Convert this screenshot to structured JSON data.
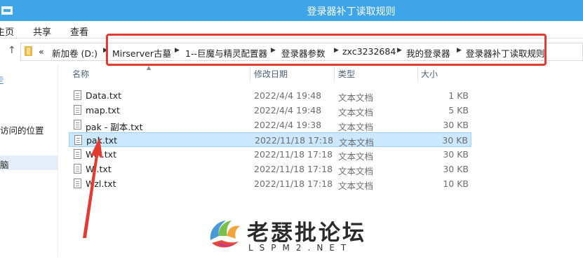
{
  "window": {
    "title": "登录器补丁读取规则"
  },
  "ribbon": {
    "tabs": [
      "主页",
      "共享",
      "查看"
    ]
  },
  "address": {
    "prefix": "«",
    "segments": [
      "新加卷 (D:)",
      "Mirserver古墓",
      "1--巨魔与精灵配置器",
      "登录器参数",
      "zxc3232684",
      "我的登录器",
      "登录器补丁读取规则"
    ]
  },
  "nav": {
    "items": [
      "走",
      "访问的位置",
      "脑"
    ]
  },
  "columns": {
    "name": "名称",
    "date": "修改日期",
    "type": "类型",
    "size": "大小"
  },
  "files": [
    {
      "name": "Data.txt",
      "date": "2022/4/4 19:48",
      "type": "文本文档",
      "size": "1 KB",
      "selected": false
    },
    {
      "name": "map.txt",
      "date": "2022/4/4 19:48",
      "type": "文本文档",
      "size": "5 KB",
      "selected": false
    },
    {
      "name": "pak - 副本.txt",
      "date": "2022/4/4 19:38",
      "type": "文本文档",
      "size": "30 KB",
      "selected": false
    },
    {
      "name": "pak.txt",
      "date": "2022/11/18 17:18",
      "type": "文本文档",
      "size": "30 KB",
      "selected": true
    },
    {
      "name": "Wel.txt",
      "date": "2022/11/18 17:18",
      "type": "文本文档",
      "size": "30 KB",
      "selected": false
    },
    {
      "name": "Wi.txt",
      "date": "2022/11/18 17:18",
      "type": "文本文档",
      "size": "30 KB",
      "selected": false
    },
    {
      "name": "Wzl.txt",
      "date": "2022/11/18 17:18",
      "type": "文本文档",
      "size": "10 KB",
      "selected": false
    }
  ],
  "watermark": {
    "title": "老瑟批论坛",
    "url": "LSPM2.NET"
  },
  "colors": {
    "titlebar": "#3ea5e8",
    "highlight": "#e43a2f",
    "selection": "#cce8ff"
  }
}
